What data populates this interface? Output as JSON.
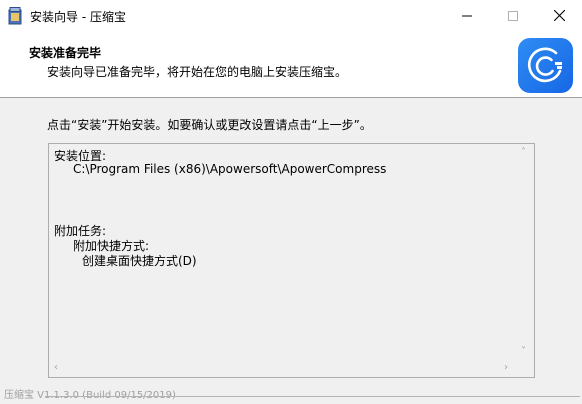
{
  "window": {
    "title": "安装向导 - 压缩宝",
    "app_icon": "installer-box-icon",
    "controls": {
      "minimize": "minimize-icon",
      "maximize": "maximize-icon",
      "close": "close-icon"
    }
  },
  "header": {
    "title": "安装准备完毕",
    "subtitle": "安装向导已准备完毕，将开始在您的电脑上安装压缩宝。",
    "logo": "apowercompress-logo-icon",
    "logo_color": "#1f7cf0"
  },
  "body": {
    "instruction": "点击“安装”开始安装。如要确认或更改设置请点击“上一步”。",
    "memo": {
      "location_heading": "安装位置:",
      "location_path": "C:\\Program Files (x86)\\Apowersoft\\ApowerCompress",
      "tasks_heading": "附加任务:",
      "tasks_group": "附加快捷方式:",
      "tasks_item": "创建桌面快捷方式(D)"
    }
  },
  "footer": {
    "version_text": "压缩宝 V1.1.3.0 (Build 09/15/2019)"
  }
}
